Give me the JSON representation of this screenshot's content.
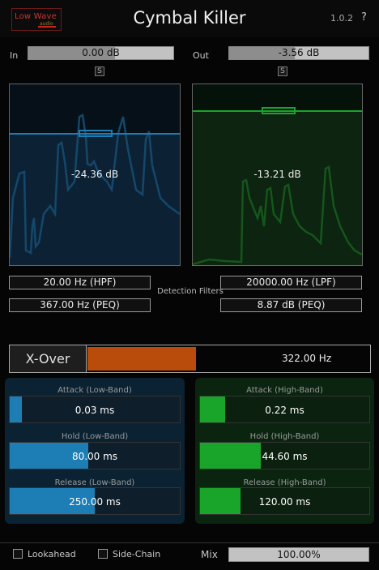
{
  "header": {
    "logo_text": "Low Wave",
    "logo_sub": "audio",
    "title": "Cymbal Killer",
    "version": "1.0.2",
    "help": "?"
  },
  "input": {
    "label": "In",
    "value": "0.00 dB",
    "level": 0.6,
    "s_label": "S"
  },
  "output": {
    "label": "Out",
    "value": "-3.56 dB",
    "level": 0.47,
    "s_label": "S"
  },
  "scope_low": {
    "value": "-24.36 dB",
    "color": "#1d7db5"
  },
  "scope_high": {
    "value": "-13.21 dB",
    "color": "#19a42a"
  },
  "detection": {
    "label": "Detection Filters",
    "hpf": "20.00 Hz (HPF)",
    "lpf": "20000.00 Hz (LPF)",
    "peq_freq": "367.00 Hz (PEQ)",
    "peq_gain": "8.87 dB (PEQ)"
  },
  "xover": {
    "label": "X-Over",
    "value": "322.00 Hz",
    "level": 0.385,
    "color": "#b94c0a"
  },
  "low_band": {
    "attack": {
      "label": "Attack (Low-Band)",
      "value": "0.03 ms",
      "level": 0.07
    },
    "hold": {
      "label": "Hold (Low-Band)",
      "value": "80.00 ms",
      "level": 0.46
    },
    "release": {
      "label": "Release (Low-Band)",
      "value": "250.00 ms",
      "level": 0.5
    }
  },
  "high_band": {
    "attack": {
      "label": "Attack (High-Band)",
      "value": "0.22 ms",
      "level": 0.15
    },
    "hold": {
      "label": "Hold (High-Band)",
      "value": "44.60 ms",
      "level": 0.36
    },
    "release": {
      "label": "Release (High-Band)",
      "value": "120.00 ms",
      "level": 0.24
    }
  },
  "footer": {
    "lookahead": "Lookahead",
    "sidechain": "Side-Chain",
    "mix_label": "Mix",
    "mix_value": "100.00%"
  }
}
